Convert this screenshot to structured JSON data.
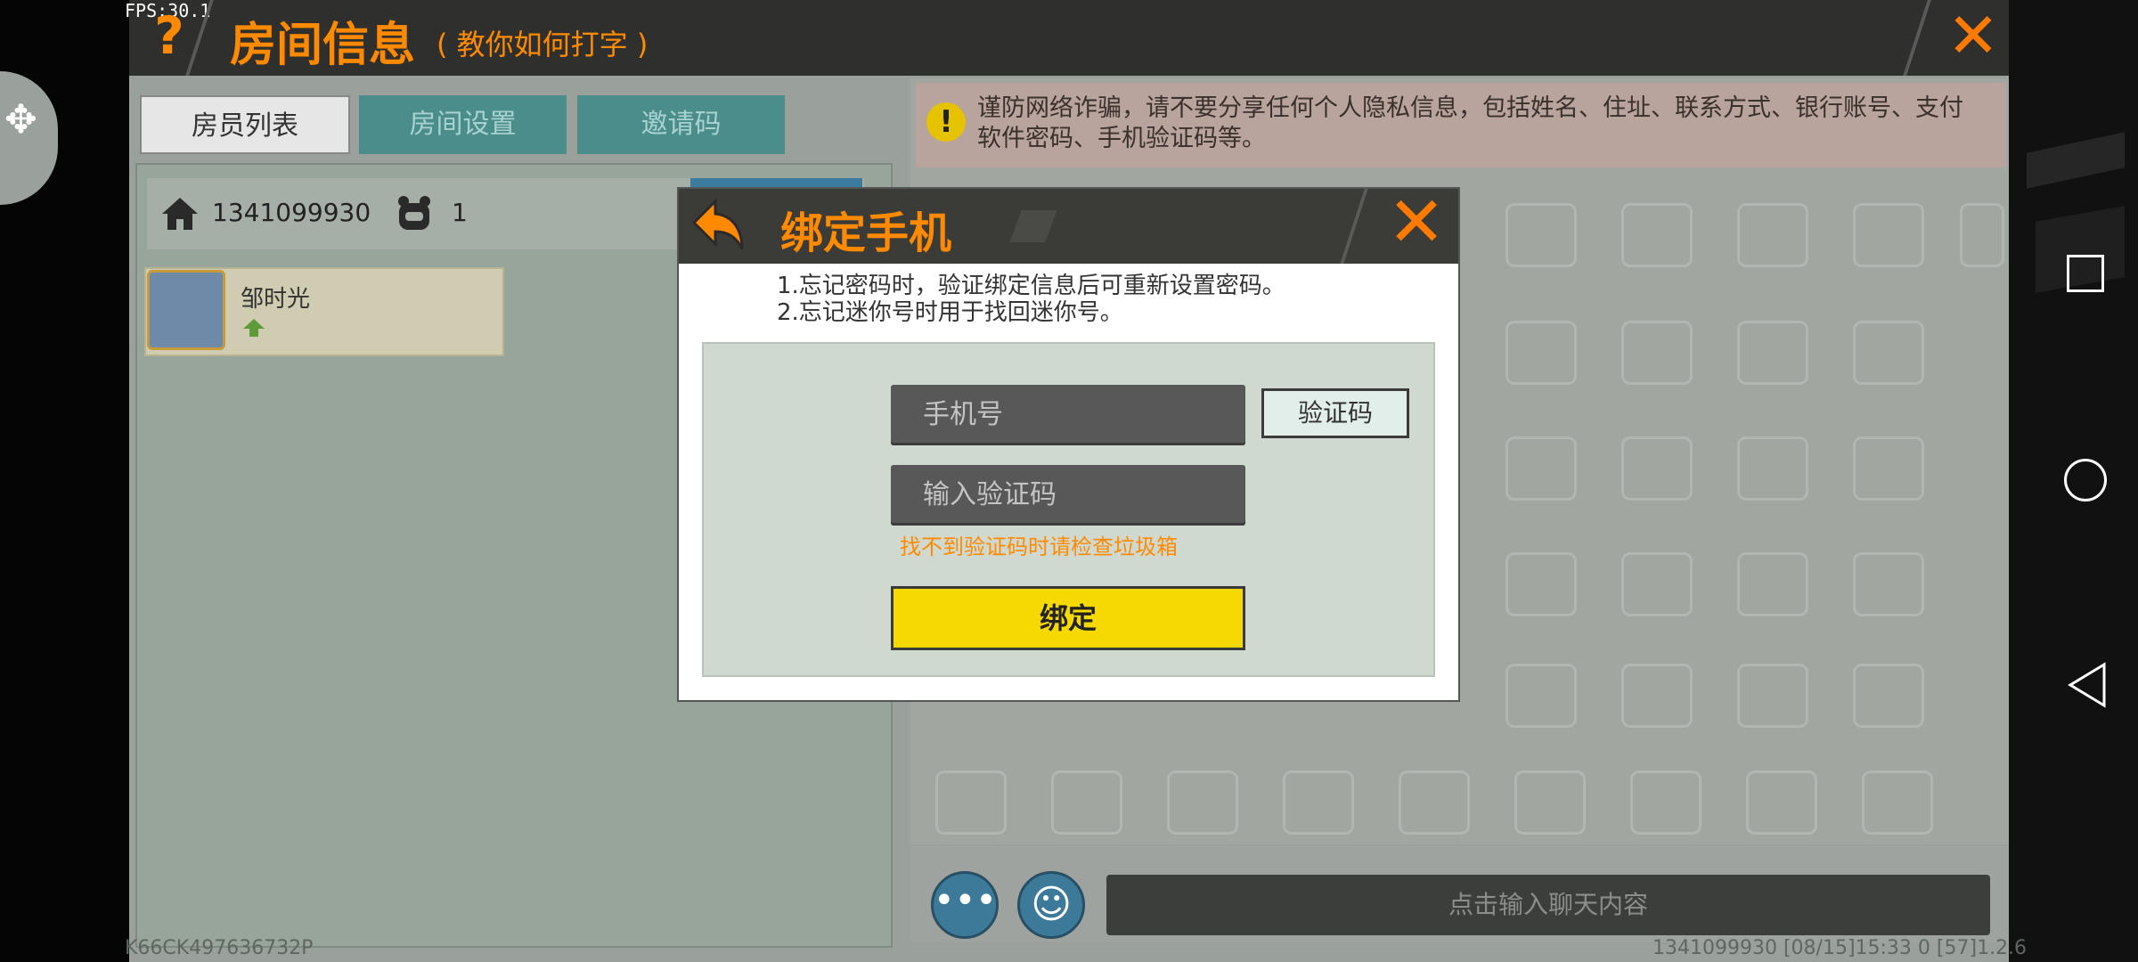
{
  "status": {
    "fps": "FPS:30.1"
  },
  "title_bar": {
    "help_icon": "question-mark-icon",
    "title": "房间信息",
    "subtitle": "( 教你如何打字 )",
    "close_icon": "close-icon"
  },
  "tabs": [
    {
      "label": "房员列表",
      "active": true
    },
    {
      "label": "房间设置",
      "active": false
    },
    {
      "label": "邀请码",
      "active": false
    }
  ],
  "room": {
    "id": "1341099930",
    "count": "1"
  },
  "members": [
    {
      "name": "邹时光"
    }
  ],
  "left_footer": "K66CK497636732P",
  "warning": {
    "text": "谨防网络诈骗，请不要分享任何个人隐私信息，包括姓名、住址、联系方式、银行账号、支付软件密码、手机验证码等。"
  },
  "chat": {
    "placeholder": "点击输入聊天内容",
    "more_icon": "ellipsis-icon",
    "emoji_icon": "smiley-icon"
  },
  "right_footer": "1341099930   [08/15]15:33 0   [57]1.2.6",
  "modal": {
    "title": "绑定手机",
    "note_1": "1.忘记密码时，验证绑定信息后可重新设置密码。",
    "note_2": "2.忘记迷你号时用于找回迷你号。",
    "phone_placeholder": "手机号",
    "code_placeholder": "输入验证码",
    "get_code_label": "验证码",
    "spam_hint": "找不到验证码时请检查垃圾箱",
    "bind_label": "绑定"
  },
  "colors": {
    "accent_orange": "#ff8a00",
    "teal_tab": "#4b8d8b",
    "bind_yellow": "#f5d900",
    "warning_bg": "#b8a39d"
  }
}
